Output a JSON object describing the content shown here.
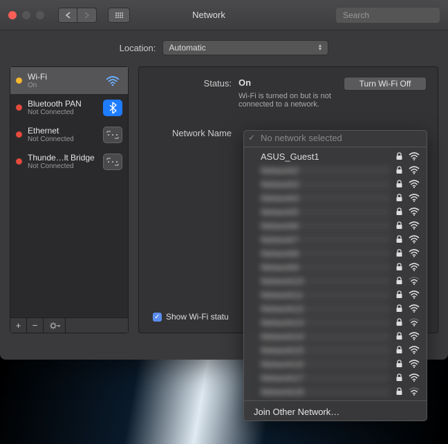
{
  "window": {
    "title": "Network"
  },
  "search": {
    "placeholder": "Search"
  },
  "location": {
    "label": "Location:",
    "value": "Automatic"
  },
  "interfaces": [
    {
      "name": "Wi-Fi",
      "status": "On",
      "kind": "wifi",
      "dot": "on",
      "selected": true
    },
    {
      "name": "Bluetooth PAN",
      "status": "Not Connected",
      "kind": "bt",
      "dot": "off",
      "selected": false
    },
    {
      "name": "Ethernet",
      "status": "Not Connected",
      "kind": "eth",
      "dot": "off",
      "selected": false
    },
    {
      "name": "Thunde…lt Bridge",
      "status": "Not Connected",
      "kind": "tb",
      "dot": "off",
      "selected": false
    }
  ],
  "main": {
    "status_label": "Status:",
    "status_value": "On",
    "toggle_label": "Turn Wi-Fi Off",
    "status_desc": "Wi-Fi is turned on but is not connected to a network.",
    "netname_label": "Network Name",
    "show_label": "Show Wi-Fi statu"
  },
  "dropdown": {
    "header": "No network selected",
    "networks": [
      {
        "ssid": "ASUS_Guest1",
        "locked": true,
        "bars": 3,
        "blurred": false
      },
      {
        "ssid": "Network2",
        "locked": true,
        "bars": 3,
        "blurred": true
      },
      {
        "ssid": "Network3",
        "locked": true,
        "bars": 3,
        "blurred": true
      },
      {
        "ssid": "Network4",
        "locked": true,
        "bars": 3,
        "blurred": true
      },
      {
        "ssid": "Network5",
        "locked": true,
        "bars": 3,
        "blurred": true
      },
      {
        "ssid": "Network6",
        "locked": true,
        "bars": 3,
        "blurred": true
      },
      {
        "ssid": "Network7",
        "locked": true,
        "bars": 3,
        "blurred": true
      },
      {
        "ssid": "Network8",
        "locked": true,
        "bars": 3,
        "blurred": true
      },
      {
        "ssid": "Network9",
        "locked": true,
        "bars": 3,
        "blurred": true
      },
      {
        "ssid": "Network10",
        "locked": true,
        "bars": 2,
        "blurred": true
      },
      {
        "ssid": "Network11",
        "locked": true,
        "bars": 3,
        "blurred": true
      },
      {
        "ssid": "Network12",
        "locked": true,
        "bars": 3,
        "blurred": true
      },
      {
        "ssid": "Network13",
        "locked": true,
        "bars": 2,
        "blurred": true
      },
      {
        "ssid": "Network14",
        "locked": true,
        "bars": 3,
        "blurred": true
      },
      {
        "ssid": "Network15",
        "locked": true,
        "bars": 3,
        "blurred": true
      },
      {
        "ssid": "Network16",
        "locked": true,
        "bars": 3,
        "blurred": true
      },
      {
        "ssid": "Network17",
        "locked": true,
        "bars": 3,
        "blurred": true
      },
      {
        "ssid": "Network18",
        "locked": true,
        "bars": 2,
        "blurred": true
      }
    ],
    "join_label": "Join Other Network…"
  }
}
